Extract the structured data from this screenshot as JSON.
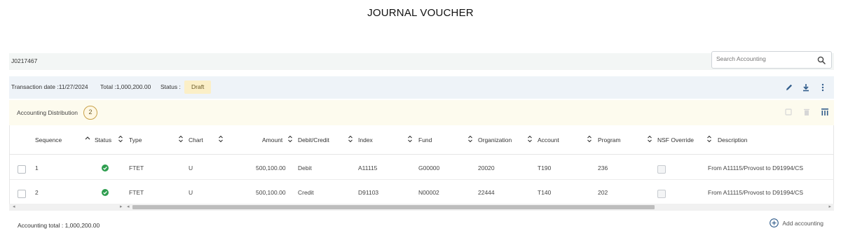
{
  "page_title": "JOURNAL VOUCHER",
  "voucher_id": "J0217467",
  "search": {
    "placeholder": "Search Accounting"
  },
  "transaction": {
    "date_label": "Transaction date :",
    "date": "11/27/2024",
    "total_label": "Total :",
    "total": "1,000,200.00",
    "status_label": "Status :",
    "status": "Draft"
  },
  "distribution": {
    "label": "Accounting Distribution",
    "count": "2"
  },
  "table": {
    "columns": [
      "Sequence",
      "Status",
      "Type",
      "Chart",
      "Amount",
      "Debit/Credit",
      "Index",
      "Fund",
      "Organization",
      "Account",
      "Program",
      "NSF Override",
      "Description"
    ],
    "rows": [
      {
        "sequence": "1",
        "status": "approved",
        "type": "FTET",
        "chart": "U",
        "amount": "500,100.00",
        "debit_credit": "Debit",
        "index": "A11115",
        "fund": "G00000",
        "organization": "20020",
        "account": "T190",
        "program": "236",
        "description": "From A11115/Provost to D91994/CS"
      },
      {
        "sequence": "2",
        "status": "approved",
        "type": "FTET",
        "chart": "U",
        "amount": "500,100.00",
        "debit_credit": "Credit",
        "index": "D91103",
        "fund": "N00002",
        "organization": "22444",
        "account": "T140",
        "program": "202",
        "description": "From A11115/Provost to D91994/CS"
      }
    ]
  },
  "footer": {
    "total_label": "Accounting total : 1,000,200.00",
    "add_label": "Add accounting"
  },
  "colors": {
    "status_ok": "#2e9e4f",
    "draft_badge_bg": "#fbefc7",
    "accent_icon": "#2f5b8a",
    "scroll_thumb": "#bdbdbd"
  }
}
